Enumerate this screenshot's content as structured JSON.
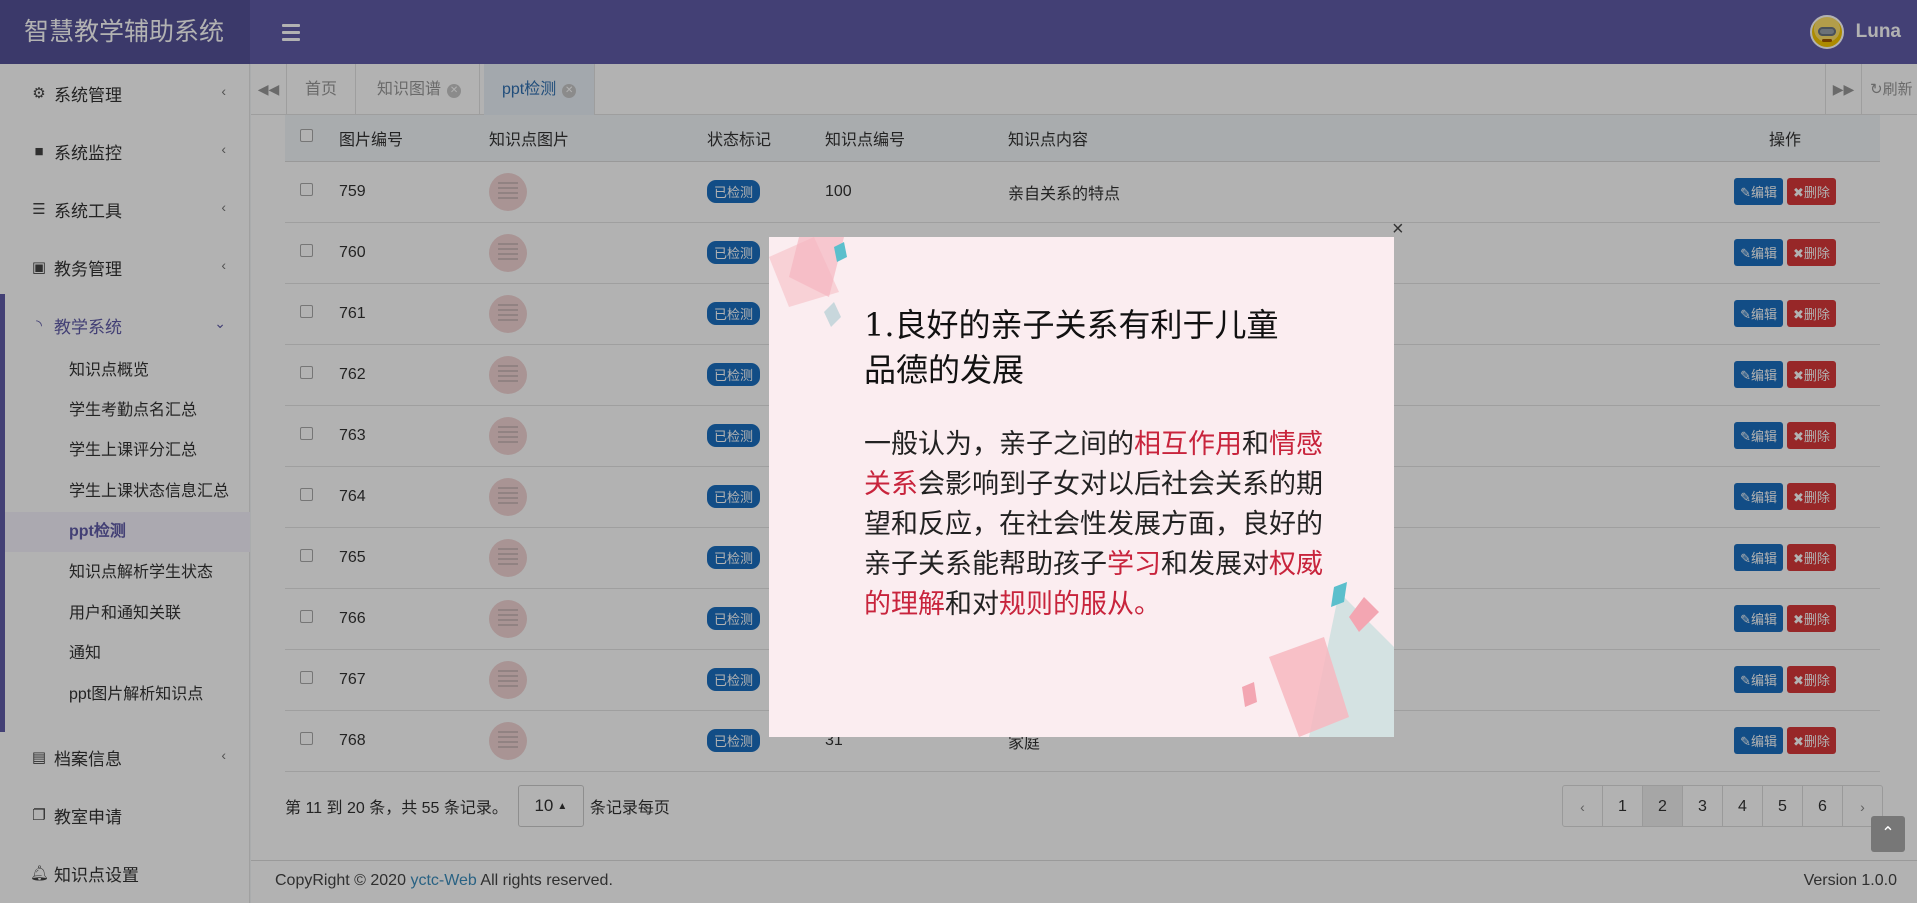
{
  "app": {
    "title": "智慧教学辅助系统",
    "user_name": "Luna"
  },
  "sidebar": {
    "items": [
      {
        "label": "系统管理",
        "icon": "gear-icon"
      },
      {
        "label": "系统监控",
        "icon": "video-icon"
      },
      {
        "label": "系统工具",
        "icon": "bars-icon"
      },
      {
        "label": "教务管理",
        "icon": "id-card-icon"
      },
      {
        "label": "教学系统",
        "icon": "rss-icon"
      },
      {
        "label": "档案信息",
        "icon": "address-book-icon"
      },
      {
        "label": "教室申请",
        "icon": "copy-icon"
      },
      {
        "label": "知识点设置",
        "icon": "bell-icon"
      }
    ],
    "sub_items": [
      "知识点概览",
      "学生考勤点名汇总",
      "学生上课评分汇总",
      "学生上课状态信息汇总",
      "ppt检测",
      "知识点解析学生状态",
      "用户和通知关联",
      "通知",
      "ppt图片解析知识点"
    ]
  },
  "tabs": {
    "items": [
      "首页",
      "知识图谱",
      "ppt检测"
    ],
    "refresh_label": "刷新"
  },
  "table": {
    "headers": [
      "图片编号",
      "知识点图片",
      "状态标记",
      "知识点编号",
      "知识点内容",
      "操作"
    ],
    "rows": [
      {
        "id": "759",
        "status": "已检测",
        "kp_id": "100",
        "content": "亲自关系的特点"
      },
      {
        "id": "760",
        "status": "已检测",
        "kp_id": "",
        "content": ""
      },
      {
        "id": "761",
        "status": "已检测",
        "kp_id": "",
        "content": ""
      },
      {
        "id": "762",
        "status": "已检测",
        "kp_id": "",
        "content": ""
      },
      {
        "id": "763",
        "status": "已检测",
        "kp_id": "",
        "content": ""
      },
      {
        "id": "764",
        "status": "已检测",
        "kp_id": "",
        "content": ""
      },
      {
        "id": "765",
        "status": "已检测",
        "kp_id": "",
        "content": ""
      },
      {
        "id": "766",
        "status": "已检测",
        "kp_id": "",
        "content": ""
      },
      {
        "id": "767",
        "status": "已检测",
        "kp_id": "",
        "content": ""
      },
      {
        "id": "768",
        "status": "已检测",
        "kp_id": "31",
        "content": "家庭"
      }
    ],
    "edit_label": "编辑",
    "delete_label": "删除"
  },
  "pagination": {
    "info": "第 11 到 20 条，共 55 条记录。",
    "page_size": "10",
    "page_size_suffix": "条记录每页",
    "prev": "‹",
    "next": "›",
    "pages": [
      "1",
      "2",
      "3",
      "4",
      "5",
      "6"
    ],
    "current_page": "2"
  },
  "footer": {
    "copyright_prefix": "CopyRight © 2020",
    "link": "yctc-Web",
    "copyright_suffix": "All rights reserved.",
    "version": "Version 1.0.0"
  },
  "modal": {
    "close": "×",
    "slide_title": "1.良好的亲子关系有利于儿童品德的发展",
    "slide_body": [
      {
        "text": "一般认为，亲子之间的",
        "hl": false
      },
      {
        "text": "相互作用",
        "hl": true
      },
      {
        "text": "和",
        "hl": false
      },
      {
        "text": "情感关系",
        "hl": true
      },
      {
        "text": "会影响到子女对以后社会关系的期望和反应，在社会性发展方面，良好的亲子关系能帮助孩子",
        "hl": false
      },
      {
        "text": "学习",
        "hl": true
      },
      {
        "text": "和发展对",
        "hl": false
      },
      {
        "text": "权威的理解",
        "hl": true
      },
      {
        "text": "和对",
        "hl": false
      },
      {
        "text": "规则的服从。",
        "hl": true
      }
    ]
  },
  "colors": {
    "header": "#605ca8",
    "brand": "#555299",
    "primary_button": "#1a6fc0",
    "danger_button": "#d9383a",
    "slide_highlight": "#c8243c",
    "slide_bg": "#fbedf0"
  }
}
